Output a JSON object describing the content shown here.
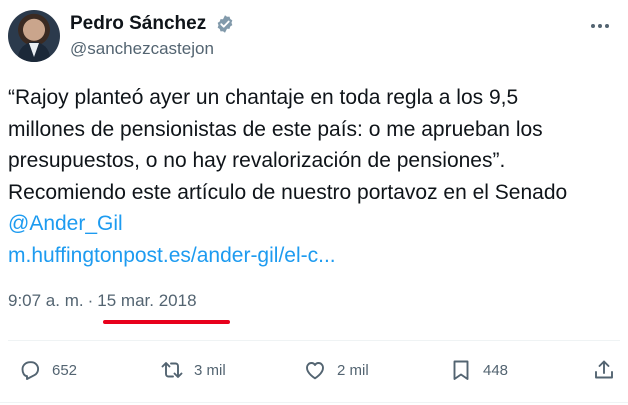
{
  "author": {
    "display_name": "Pedro Sánchez",
    "handle": "@sanchezcastejon",
    "verified_color": "#829aab"
  },
  "tweet": {
    "lines": [
      "“Rajoy planteó ayer un chantaje en toda regla a los 9,5",
      "millones de pensionistas de este país: o me aprueban los",
      "presupuestos, o no hay revalorización de pensiones”.",
      "Recomiendo este artículo de nuestro portavoz en el Senado"
    ],
    "mention": "@Ander_Gil",
    "url": "m.huffingtonpost.es/ander-gil/el-c..."
  },
  "meta": {
    "time": "9:07 a. m.",
    "separator": "·",
    "date": "15 mar. 2018",
    "highlight_color": "#e8001c"
  },
  "actions": {
    "replies": "652",
    "retweets": "3 mil",
    "likes": "2 mil",
    "bookmarks": "448"
  },
  "icons": [
    "verified-badge-icon",
    "more-icon",
    "reply-icon",
    "retweet-icon",
    "like-icon",
    "bookmark-icon",
    "share-icon"
  ],
  "colors": {
    "link": "#1d9bf0",
    "secondary_text": "#536471",
    "primary_text": "#0f1419"
  }
}
